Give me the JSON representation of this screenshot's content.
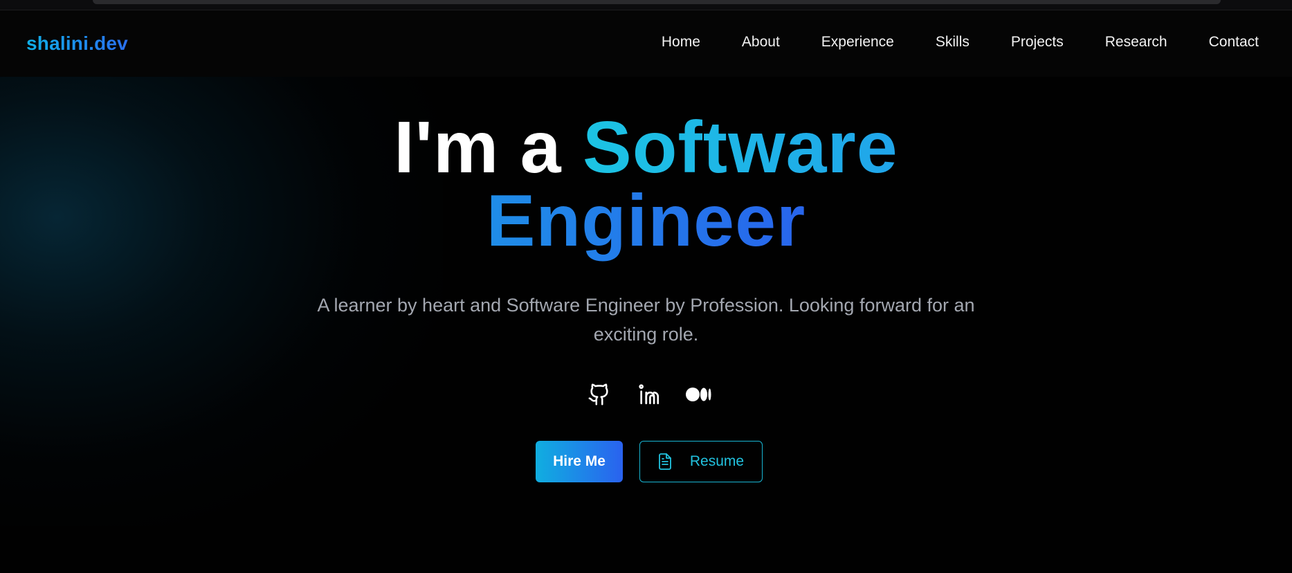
{
  "nav": {
    "logo": "shalini.dev",
    "links": [
      "Home",
      "About",
      "Experience",
      "Skills",
      "Projects",
      "Research",
      "Contact"
    ]
  },
  "hero": {
    "prefix": "I'm a ",
    "highlight_1": "Software",
    "highlight_2": "Engineer",
    "subtitle_line1": "A learner by heart and Software Engineer by Profession. Looking forward for an",
    "subtitle_line2": "exciting role."
  },
  "socials": [
    {
      "name": "github",
      "icon": "github-icon"
    },
    {
      "name": "linkedin",
      "icon": "linkedin-icon"
    },
    {
      "name": "medium",
      "icon": "medium-icon"
    }
  ],
  "actions": {
    "hire_label": "Hire Me",
    "resume_label": "Resume",
    "resume_icon": "document-icon"
  },
  "colors": {
    "background": "#010101",
    "accent_cyan": "#1cc4e4",
    "accent_blue": "#2a62ef",
    "subtitle": "#a3a7b0"
  }
}
